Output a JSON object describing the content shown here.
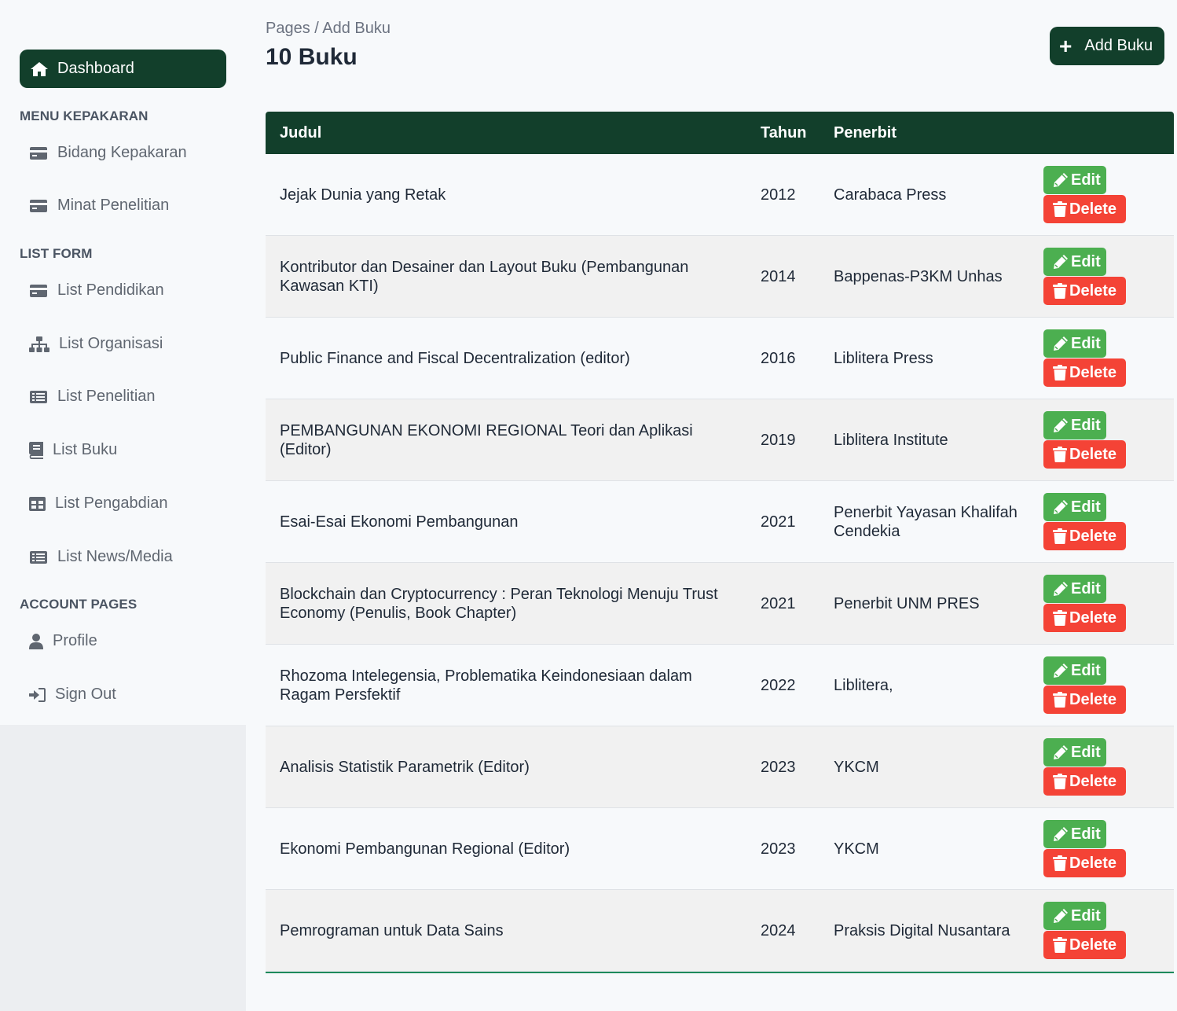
{
  "sidebar": {
    "dashboard_label": "Dashboard",
    "sections": {
      "menu_kepakaran": "MENU KEPAKARAN",
      "list_form": "LIST FORM",
      "account_pages": "ACCOUNT PAGES"
    },
    "items": {
      "bidang": "Bidang Kepakaran",
      "minat": "Minat Penelitian",
      "pendidikan": "List Pendidikan",
      "organisasi": "List Organisasi",
      "penelitian": "List Penelitian",
      "buku": "List Buku",
      "pengabdian": "List Pengabdian",
      "news": "List News/Media",
      "profile": "Profile",
      "signout": "Sign Out"
    }
  },
  "header": {
    "breadcrumb": "Pages / Add Buku",
    "title": "10 Buku",
    "add_label": "Add Buku"
  },
  "table": {
    "columns": [
      "Judul",
      "Tahun",
      "Penerbit"
    ],
    "edit_label": "Edit",
    "delete_label": "Delete",
    "rows": [
      {
        "judul": "Jejak Dunia yang Retak",
        "tahun": "2012",
        "penerbit": "Carabaca Press"
      },
      {
        "judul": "Kontributor dan Desainer dan Layout Buku (Pembangunan Kawasan KTI)",
        "tahun": "2014",
        "penerbit": "Bappenas-P3KM Unhas"
      },
      {
        "judul": "Public Finance and Fiscal Decentralization (editor)",
        "tahun": "2016",
        "penerbit": "Liblitera Press"
      },
      {
        "judul": "PEMBANGUNAN EKONOMI REGIONAL Teori dan Aplikasi (Editor)",
        "tahun": "2019",
        "penerbit": "Liblitera Institute"
      },
      {
        "judul": "Esai-Esai Ekonomi Pembangunan",
        "tahun": "2021",
        "penerbit": "Penerbit Yayasan Khalifah Cendekia"
      },
      {
        "judul": "Blockchain dan Cryptocurrency : Peran Teknologi Menuju Trust Economy (Penulis, Book Chapter)",
        "tahun": "2021",
        "penerbit": "Penerbit UNM PRES"
      },
      {
        "judul": "Rhozoma Intelegensia, Problematika Keindonesiaan dalam Ragam Persfektif",
        "tahun": "2022",
        "penerbit": "Liblitera,"
      },
      {
        "judul": "Analisis Statistik Parametrik (Editor)",
        "tahun": "2023",
        "penerbit": "YKCM"
      },
      {
        "judul": "Ekonomi Pembangunan Regional (Editor)",
        "tahun": "2023",
        "penerbit": "YKCM"
      },
      {
        "judul": "Pemrograman untuk Data Sains",
        "tahun": "2024",
        "penerbit": "Praksis Digital Nusantara"
      }
    ]
  },
  "colors": {
    "primary": "#123f2b",
    "edit": "#4caf50",
    "delete": "#f44336"
  }
}
